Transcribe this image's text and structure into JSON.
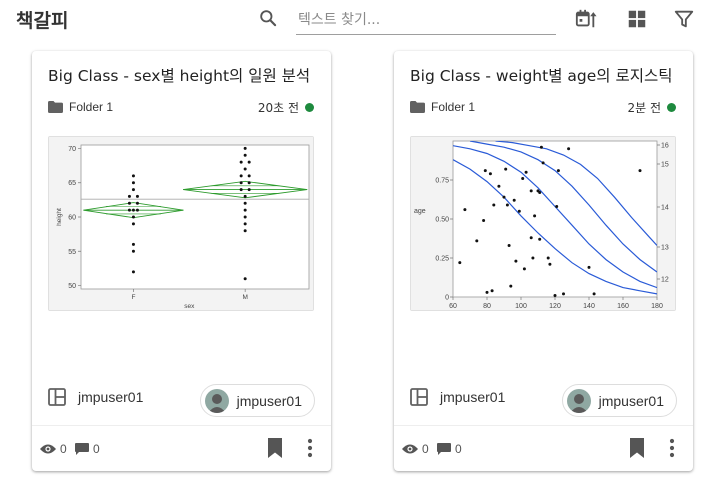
{
  "app": {
    "title": "책갈피"
  },
  "search": {
    "placeholder": "텍스트 찾기..."
  },
  "toolbar": {
    "icons": [
      "search-icon",
      "sort-date-icon",
      "grid-view-icon",
      "filter-icon"
    ]
  },
  "cards": [
    {
      "title": "Big Class - sex별 height의 일원 분석",
      "folder": "Folder 1",
      "time": "20초 전",
      "status_color": "#1e8a3e",
      "owner": "jmpuser01",
      "chip_user": "jmpuser01",
      "views": "0",
      "comments": "0",
      "chart_data": {
        "type": "scatter",
        "title": "",
        "xlabel": "sex",
        "ylabel": "height",
        "categories": [
          "F",
          "M"
        ],
        "yticks": [
          "70",
          "65",
          "60",
          "55",
          "50"
        ],
        "ylim": [
          49.5,
          70.5
        ],
        "grand_mean": 62.6,
        "diamonds": [
          {
            "category": "F",
            "mean": 61.0,
            "ci": [
              59.9,
              62.1
            ]
          },
          {
            "category": "M",
            "mean": 64.0,
            "ci": [
              62.8,
              65.2
            ]
          }
        ],
        "points": [
          {
            "category": "F",
            "y": [
              66,
              65,
              64,
              63,
              63,
              62,
              62,
              61,
              61,
              61,
              60,
              59,
              56,
              55,
              52
            ],
            "offset": [
              0,
              0,
              0,
              -1,
              1,
              -1,
              1,
              -1,
              0,
              1,
              0,
              0,
              0,
              0,
              0
            ]
          },
          {
            "category": "M",
            "y": [
              70,
              69,
              68,
              68,
              67,
              66,
              66,
              65,
              65,
              64,
              64,
              63,
              62,
              61,
              60,
              59,
              58,
              51
            ],
            "offset": [
              0,
              0,
              -1,
              1,
              0,
              -1,
              1,
              -1,
              1,
              -1,
              1,
              0,
              0,
              0,
              0,
              0,
              0,
              0
            ]
          }
        ],
        "grid": false
      }
    },
    {
      "title": "Big Class - weight별 age의 로지스틱",
      "folder": "Folder 1",
      "time": "2분 전",
      "status_color": "#1e8a3e",
      "owner": "jmpuser01",
      "chip_user": "jmpuser01",
      "views": "0",
      "comments": "0",
      "chart_data": {
        "type": "line",
        "title": "",
        "xlabel": "",
        "ylabel": "age",
        "xticks": [
          "60",
          "80",
          "100",
          "120",
          "140",
          "160",
          "180"
        ],
        "xlim": [
          60,
          180
        ],
        "yticks": [
          "0",
          "0.25",
          "0.50",
          "0.75"
        ],
        "ylim": [
          0,
          1
        ],
        "y2ticks": [
          "12",
          "13",
          "14",
          "15",
          "16"
        ],
        "curve_color": "#2a5bd7",
        "series": [
          {
            "x": [
              60,
              70,
              80,
              90,
              100,
              110,
              120,
              130,
              140,
              150,
              160,
              170,
              180
            ],
            "values": [
              0.88,
              0.82,
              0.74,
              0.64,
              0.52,
              0.41,
              0.31,
              0.22,
              0.15,
              0.1,
              0.06,
              0.04,
              0.02
            ]
          },
          {
            "x": [
              60,
              70,
              80,
              90,
              100,
              110,
              120,
              130,
              140,
              150,
              160,
              170,
              180
            ],
            "values": [
              0.97,
              0.95,
              0.92,
              0.87,
              0.8,
              0.7,
              0.58,
              0.46,
              0.34,
              0.24,
              0.16,
              0.1,
              0.06
            ]
          },
          {
            "x": [
              70,
              80,
              90,
              100,
              110,
              120,
              130,
              140,
              150,
              160,
              170,
              180
            ],
            "values": [
              1.0,
              0.98,
              0.96,
              0.93,
              0.88,
              0.81,
              0.71,
              0.59,
              0.46,
              0.34,
              0.24,
              0.16
            ]
          },
          {
            "x": [
              85,
              95,
              105,
              115,
              125,
              135,
              145,
              155,
              165,
              175,
              180
            ],
            "values": [
              1.0,
              0.99,
              0.97,
              0.95,
              0.91,
              0.85,
              0.76,
              0.64,
              0.51,
              0.39,
              0.33
            ]
          }
        ],
        "points": [
          [
            64,
            0.22
          ],
          [
            67,
            0.56
          ],
          [
            74,
            0.36
          ],
          [
            78,
            0.49
          ],
          [
            79,
            0.81
          ],
          [
            80,
            0.03
          ],
          [
            82,
            0.79
          ],
          [
            83,
            0.04
          ],
          [
            84,
            0.59
          ],
          [
            87,
            0.71
          ],
          [
            90,
            0.64
          ],
          [
            91,
            0.82
          ],
          [
            92,
            0.59
          ],
          [
            93,
            0.33
          ],
          [
            94,
            0.07
          ],
          [
            96,
            0.62
          ],
          [
            97,
            0.23
          ],
          [
            99,
            0.55
          ],
          [
            101,
            0.76
          ],
          [
            102,
            0.18
          ],
          [
            103,
            0.8
          ],
          [
            106,
            0.68
          ],
          [
            106,
            0.38
          ],
          [
            107,
            0.25
          ],
          [
            108,
            0.52
          ],
          [
            110,
            0.68
          ],
          [
            111,
            0.67
          ],
          [
            111,
            0.37
          ],
          [
            112,
            0.96
          ],
          [
            113,
            0.86
          ],
          [
            116,
            0.25
          ],
          [
            117,
            0.21
          ],
          [
            120,
            0.01
          ],
          [
            121,
            0.58
          ],
          [
            122,
            0.81
          ],
          [
            125,
            0.02
          ],
          [
            128,
            0.95
          ],
          [
            140,
            0.19
          ],
          [
            143,
            0.02
          ],
          [
            170,
            0.81
          ]
        ],
        "grid": false
      }
    }
  ]
}
